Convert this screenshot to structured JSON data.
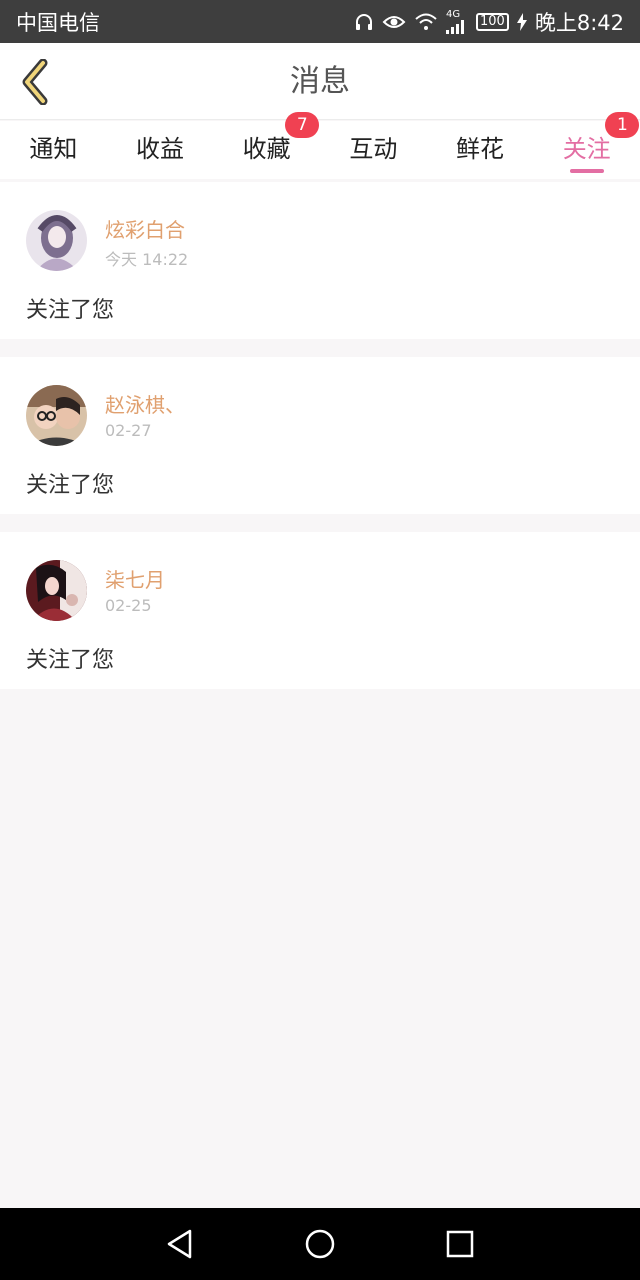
{
  "status_bar": {
    "carrier": "中国电信",
    "network": "4G",
    "battery": "100",
    "time": "晚上8:42",
    "icons": [
      "headset-icon",
      "eye-icon",
      "wifi-icon",
      "signal-icon",
      "battery-icon",
      "charging-icon"
    ]
  },
  "header": {
    "title": "消息",
    "back_icon": "chevron-left-icon"
  },
  "tabs": [
    {
      "label": "通知",
      "badge": ""
    },
    {
      "label": "收益",
      "badge": ""
    },
    {
      "label": "收藏",
      "badge": "7"
    },
    {
      "label": "互动",
      "badge": ""
    },
    {
      "label": "鲜花",
      "badge": ""
    },
    {
      "label": "关注",
      "badge": "1",
      "active": true
    }
  ],
  "colors": {
    "accent": "#e36ea3",
    "badge": "#f04152",
    "username": "#e0a06f",
    "background": "#f8f6f7"
  },
  "messages": [
    {
      "name": "炫彩白合",
      "time": "今天 14:22",
      "text": "关注了您"
    },
    {
      "name": "赵泳棋、",
      "time": "02-27",
      "text": "关注了您"
    },
    {
      "name": "柒七月",
      "time": "02-25",
      "text": "关注了您"
    }
  ],
  "navbar": {
    "icons": [
      "back-triangle-icon",
      "home-circle-icon",
      "recents-square-icon"
    ]
  }
}
